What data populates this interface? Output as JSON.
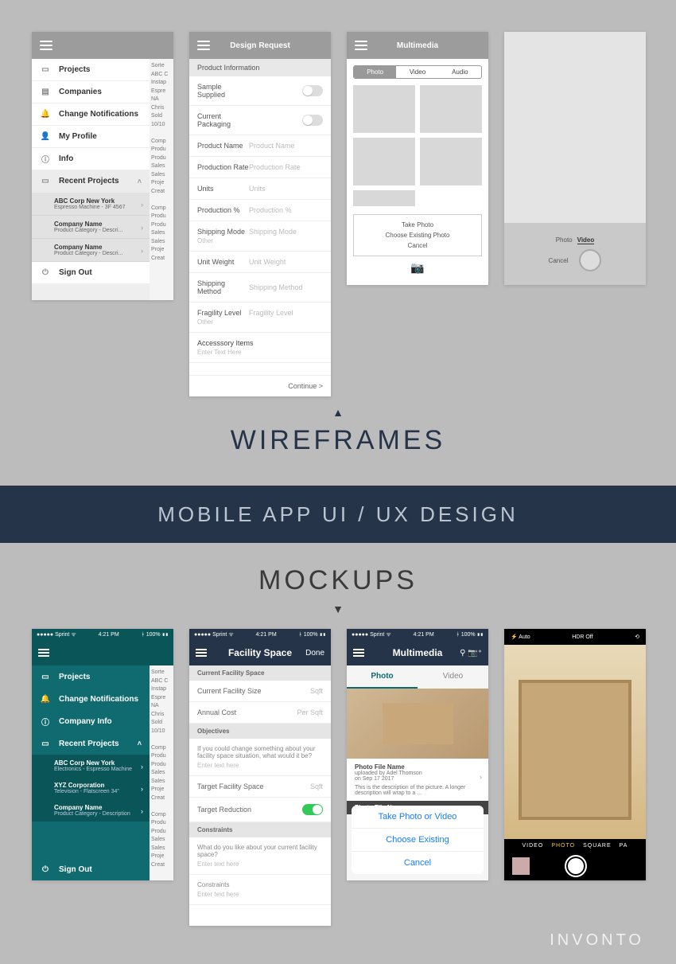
{
  "headings": {
    "wireframes": "WIREFRAMES",
    "band": "MOBILE APP UI / UX DESIGN",
    "mockups": "MOCKUPS",
    "brand": "INVONTO"
  },
  "wf1": {
    "menu": {
      "projects": "Projects",
      "companies": "Companies",
      "notifications": "Change Notifications",
      "profile": "My Profile",
      "info": "Info",
      "recent": "Recent Projects",
      "signout": "Sign Out"
    },
    "recentItems": [
      {
        "title": "ABC Corp New York",
        "desc": "Espresso Machine - 3F 4567"
      },
      {
        "title": "Company Name",
        "desc": "Product Category - Descri..."
      },
      {
        "title": "Company Name",
        "desc": "Product Category - Descri..."
      }
    ],
    "underHeader": "Sorte",
    "under": "ABC C\nInstap\nEspre\nNA\nChris\nSold\n10/10\n\nComp\nProdu\nProdu\nSales\nSales\nProje\nCreat\n\nComp\nProdu\nProdu\nSales\nSales\nProje\nCreat"
  },
  "wf2": {
    "title": "Design Request",
    "section": "Product Information",
    "fields": {
      "sample": "Sample Supplied",
      "packaging": "Current Packaging",
      "name": {
        "label": "Product Name",
        "ph": "Product Name"
      },
      "rate": {
        "label": "Production Rate",
        "ph": "Production Rate"
      },
      "units": {
        "label": "Units",
        "ph": "Units"
      },
      "pct": {
        "label": "Production %",
        "ph": "Production %"
      },
      "ship": {
        "label": "Shipping Mode",
        "ph": "Shipping Mode",
        "sub": "Other"
      },
      "weight": {
        "label": "Unit Weight",
        "ph": "Unit Weight"
      },
      "method": {
        "label": "Shipping Method",
        "ph": "Shipping Method"
      },
      "fragility": {
        "label": "Fragility Level",
        "ph": "Fragility Level",
        "sub": "Other"
      },
      "accessory": {
        "label": "Accesssory Items",
        "ph": "Enter Text Here"
      }
    },
    "continue": "Continue >"
  },
  "wf3": {
    "title": "Multimedia",
    "tabs": {
      "photo": "Photo",
      "video": "Video",
      "audio": "Audio"
    },
    "sheet": {
      "take": "Take Photo",
      "choose": "Choose Existing Photo",
      "cancel": "Cancel"
    }
  },
  "wf4": {
    "modes": {
      "photo": "Photo",
      "video": "Video"
    },
    "cancel": "Cancel"
  },
  "statusbar": {
    "carrier": "●●●●● Sprint ᯤ",
    "time": "4:21 PM",
    "battery": "ᚼ 100% ▮▮"
  },
  "mk1": {
    "menu": {
      "projects": "Projects",
      "notifications": "Change Notifications",
      "company": "Company Info",
      "recent": "Recent Projects",
      "signout": "Sign Out"
    },
    "recentItems": [
      {
        "title": "ABC Corp New York",
        "desc": "Electronics - Espresso Machine"
      },
      {
        "title": "XYZ Corporation",
        "desc": "Television - Flatscreen 34\""
      },
      {
        "title": "Company Name",
        "desc": "Product Category - Description"
      }
    ],
    "underHeader": "Sorte",
    "under": "ABC C\nInstap\nEspre\nNA\nChris\nSold\n10/10\n\nComp\nProdu\nProdu\nSales\nSales\nProje\nCreat\n\nComp\nProdu\nProdu\nSales\nSales\nProje\nCreat"
  },
  "mk2": {
    "title": "Facility Space",
    "done": "Done",
    "sections": {
      "current": "Current Facility Space",
      "objectives": "Objectives",
      "constraints": "Constraints"
    },
    "fields": {
      "size": {
        "label": "Current Facility Size",
        "ph": "Sqft"
      },
      "cost": {
        "label": "Annual Cost",
        "ph": "Per Sqft"
      },
      "objq": "If you could change something about your facility space situation, what would it be?",
      "objph": "Enter text here",
      "target": {
        "label": "Target Facility Space",
        "ph": "Sqft"
      },
      "reduction": "Target Reduction",
      "conq": "What do you like about your current facility space?",
      "conph": "Enter text here",
      "con2": "Constraints",
      "con2ph": "Enter text here"
    }
  },
  "mk3": {
    "title": "Multimedia",
    "tabs": {
      "photo": "Photo",
      "video": "Video"
    },
    "card": {
      "title": "Photo File Name",
      "by": "uploaded by Adel Thomson",
      "date": "on Sep 17 2017",
      "desc": "This is the description of the picture. A longer description will wrap to a ..."
    },
    "card2title": "Photo File Name",
    "sheet": {
      "take": "Take Photo or Video",
      "choose": "Choose Existing",
      "cancel": "Cancel"
    }
  },
  "mk4": {
    "top": {
      "flash": "⚡ Auto",
      "hdr": "HDR Off"
    },
    "modes": {
      "video": "VIDEO",
      "photo": "PHOTO",
      "square": "SQUARE",
      "pano": "PA"
    }
  }
}
